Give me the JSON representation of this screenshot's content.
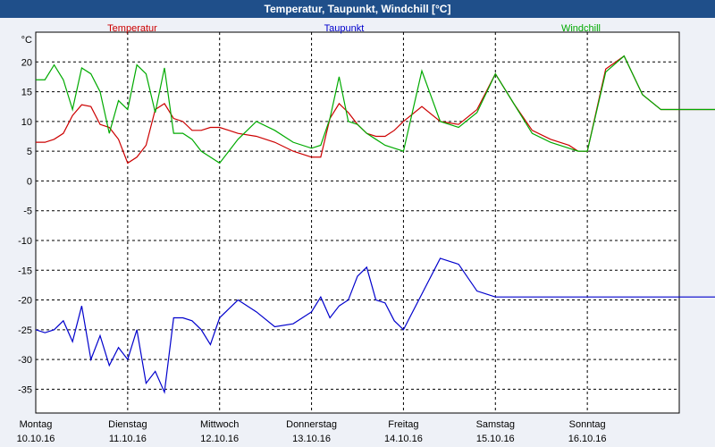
{
  "window": {
    "title": "Temperatur, Taupunkt, Windchill [°C]"
  },
  "chart_data": {
    "type": "line",
    "unit_label": "°C",
    "ylim": [
      -39,
      25
    ],
    "y_ticks": [
      20,
      15,
      10,
      5,
      0,
      -5,
      -10,
      -15,
      -20,
      -25,
      -30,
      -35
    ],
    "grid": true,
    "legend": "top",
    "x_ticks": [
      {
        "day": "Montag",
        "date": "10.10.16"
      },
      {
        "day": "Dienstag",
        "date": "11.10.16"
      },
      {
        "day": "Mittwoch",
        "date": "12.10.16"
      },
      {
        "day": "Donnerstag",
        "date": "13.10.16"
      },
      {
        "day": "Freitag",
        "date": "14.10.16"
      },
      {
        "day": "Samstag",
        "date": "15.10.16"
      },
      {
        "day": "Sonntag",
        "date": "16.10.16"
      }
    ],
    "series": [
      {
        "name": "Temperatur",
        "color": "#cc0000",
        "x": [
          0,
          0.1,
          0.2,
          0.3,
          0.4,
          0.5,
          0.6,
          0.7,
          0.8,
          0.9,
          1.0,
          1.1,
          1.2,
          1.3,
          1.4,
          1.5,
          1.6,
          1.7,
          1.8,
          1.9,
          2.0,
          2.2,
          2.4,
          2.6,
          2.8,
          3.0,
          3.1,
          3.2,
          3.3,
          3.4,
          3.5,
          3.6,
          3.7,
          3.8,
          3.9,
          4.0,
          4.2,
          4.4,
          4.6,
          4.8,
          5.0,
          5.2,
          5.4,
          5.6,
          5.8,
          5.9,
          6.0,
          6.2,
          6.4,
          6.6,
          6.8,
          7.0,
          7.2,
          7.4,
          7.5,
          7.6,
          7.7,
          7.8,
          7.9,
          8.0
        ],
        "y": [
          6.5,
          6.5,
          7,
          8,
          11,
          12.8,
          12.5,
          9.5,
          9,
          7,
          3,
          4,
          6,
          12,
          13,
          10.5,
          10,
          8.5,
          8.5,
          9,
          9,
          8,
          7.5,
          6.5,
          5,
          4,
          4,
          10.5,
          13,
          11.5,
          9.5,
          8,
          7.5,
          7.5,
          8.5,
          10,
          12.5,
          10,
          9.5,
          12,
          18,
          13,
          8.5,
          7,
          6,
          5,
          5,
          18.8,
          21,
          14.5,
          12,
          12,
          12,
          12,
          12,
          12,
          12,
          12,
          12,
          12
        ]
      },
      {
        "name": "Taupunkt",
        "color": "#0000cc",
        "x": [
          0,
          0.1,
          0.2,
          0.3,
          0.4,
          0.5,
          0.6,
          0.7,
          0.8,
          0.9,
          1.0,
          1.1,
          1.2,
          1.3,
          1.4,
          1.5,
          1.6,
          1.7,
          1.8,
          1.9,
          2.0,
          2.2,
          2.4,
          2.6,
          2.8,
          3.0,
          3.1,
          3.2,
          3.3,
          3.4,
          3.5,
          3.6,
          3.7,
          3.8,
          3.9,
          4.0,
          4.2,
          4.4,
          4.6,
          4.8,
          5.0,
          5.2,
          5.4,
          5.6,
          5.8,
          5.9,
          6.0,
          6.2,
          6.4,
          6.6,
          6.8,
          7.0,
          7.2,
          7.4,
          7.5,
          7.6,
          7.7,
          7.8,
          7.9,
          8.0
        ],
        "y": [
          -25,
          -25.5,
          -25,
          -23.5,
          -27,
          -21,
          -30,
          -26,
          -31,
          -28,
          -30,
          -25,
          -34,
          -32,
          -35.5,
          -23,
          -23,
          -23.5,
          -25,
          -27.5,
          -23,
          -20,
          -22,
          -24.5,
          -24,
          -22,
          -19.5,
          -23,
          -21,
          -20,
          -16,
          -14.5,
          -20,
          -20.5,
          -23.5,
          -25,
          -19,
          -13,
          -14,
          -18.5,
          -19.5,
          -19.5,
          -19.5,
          -19.5,
          -19.5,
          -19.5,
          -19.5,
          -19.5,
          -19.5,
          -19.5,
          -19.5,
          -19.5,
          -19.5,
          -19.5,
          -19.5,
          -19.5,
          -19.5,
          -19.5,
          -19.5,
          -19.5
        ]
      },
      {
        "name": "Windchill",
        "color": "#00aa00",
        "x": [
          0,
          0.1,
          0.2,
          0.3,
          0.4,
          0.5,
          0.6,
          0.7,
          0.8,
          0.9,
          1.0,
          1.1,
          1.2,
          1.3,
          1.4,
          1.5,
          1.6,
          1.7,
          1.8,
          1.9,
          2.0,
          2.2,
          2.4,
          2.6,
          2.8,
          3.0,
          3.1,
          3.2,
          3.3,
          3.4,
          3.5,
          3.6,
          3.7,
          3.8,
          3.9,
          4.0,
          4.2,
          4.4,
          4.6,
          4.8,
          5.0,
          5.2,
          5.4,
          5.6,
          5.8,
          5.9,
          6.0,
          6.2,
          6.4,
          6.6,
          6.8,
          7.0,
          7.2,
          7.4,
          7.5,
          7.6,
          7.7,
          7.8,
          7.9,
          8.0
        ],
        "y": [
          17,
          17,
          19.5,
          17,
          12,
          19,
          18,
          15,
          8,
          13.5,
          12,
          19.5,
          18,
          11.5,
          19,
          8,
          8,
          7,
          5,
          4,
          3,
          7,
          10,
          8.5,
          6.5,
          5.5,
          6,
          10.5,
          17.5,
          10,
          9.5,
          8,
          7,
          6,
          5.5,
          5,
          18.5,
          10,
          9,
          11.5,
          18,
          13,
          8,
          6.5,
          5.5,
          5,
          5,
          18.3,
          21,
          14.5,
          12,
          12,
          12,
          12,
          12,
          12,
          12,
          12,
          12,
          12
        ]
      }
    ]
  }
}
